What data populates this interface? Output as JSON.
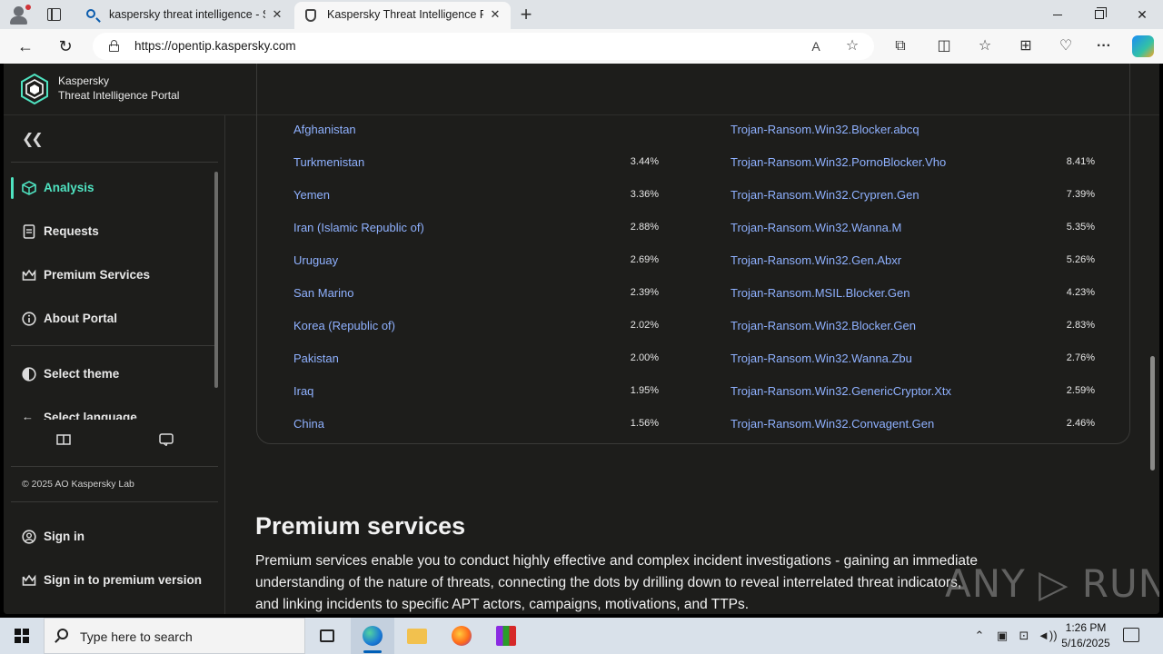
{
  "browser": {
    "tabs": [
      {
        "title": "kaspersky threat intelligence - Se",
        "icon": "search-icon",
        "active": false
      },
      {
        "title": "Kaspersky Threat Intelligence Por",
        "icon": "shield-icon",
        "active": true
      }
    ],
    "url": "https://opentip.kaspersky.com",
    "window_controls": {
      "minimize": "–",
      "close": "✕"
    },
    "nav": {
      "back": "←",
      "reload": "↻"
    },
    "toolbar": {
      "read_aloud": "A᷊",
      "favorite": "☆",
      "extensions": "⧉",
      "split": "◫",
      "favorites": "☆",
      "collections": "⊞",
      "performance": "♡",
      "more": "···"
    }
  },
  "header": {
    "brand_line1": "Kaspersky",
    "brand_line2": "Threat Intelligence Portal"
  },
  "sidebar": {
    "collapse": "«",
    "items": [
      {
        "label": "Analysis",
        "icon": "cube-icon",
        "active": true
      },
      {
        "label": "Requests",
        "icon": "document-icon",
        "active": false
      },
      {
        "label": "Premium Services",
        "icon": "crown-icon",
        "active": false
      },
      {
        "label": "About Portal",
        "icon": "info-icon",
        "active": false
      }
    ],
    "select_theme": "Select theme",
    "select_language": "Select language",
    "copyright": "© 2025 AO Kaspersky Lab",
    "sign_in": "Sign in",
    "sign_in_premium": "Sign in to premium version"
  },
  "stats_rows": [
    {
      "country": "Afghanistan",
      "country_pct": "",
      "verdict": "Trojan-Ransom.Win32.Blocker.abcq",
      "verdict_pct": ""
    },
    {
      "country": "Turkmenistan",
      "country_pct": "3.44%",
      "verdict": "Trojan-Ransom.Win32.PornoBlocker.Vho",
      "verdict_pct": "8.41%"
    },
    {
      "country": "Yemen",
      "country_pct": "3.36%",
      "verdict": "Trojan-Ransom.Win32.Crypren.Gen",
      "verdict_pct": "7.39%"
    },
    {
      "country": "Iran (Islamic Republic of)",
      "country_pct": "2.88%",
      "verdict": "Trojan-Ransom.Win32.Wanna.M",
      "verdict_pct": "5.35%"
    },
    {
      "country": "Uruguay",
      "country_pct": "2.69%",
      "verdict": "Trojan-Ransom.Win32.Gen.Abxr",
      "verdict_pct": "5.26%"
    },
    {
      "country": "San Marino",
      "country_pct": "2.39%",
      "verdict": "Trojan-Ransom.MSIL.Blocker.Gen",
      "verdict_pct": "4.23%"
    },
    {
      "country": "Korea (Republic of)",
      "country_pct": "2.02%",
      "verdict": "Trojan-Ransom.Win32.Blocker.Gen",
      "verdict_pct": "2.83%"
    },
    {
      "country": "Pakistan",
      "country_pct": "2.00%",
      "verdict": "Trojan-Ransom.Win32.Wanna.Zbu",
      "verdict_pct": "2.76%"
    },
    {
      "country": "Iraq",
      "country_pct": "1.95%",
      "verdict": "Trojan-Ransom.Win32.GenericCryptor.Xtx",
      "verdict_pct": "2.59%"
    },
    {
      "country": "China",
      "country_pct": "1.56%",
      "verdict": "Trojan-Ransom.Win32.Convagent.Gen",
      "verdict_pct": "2.46%"
    }
  ],
  "premium": {
    "title": "Premium services",
    "text": "Premium services enable you to conduct highly effective and complex incident investigations - gaining an immediate understanding of the nature of threats, connecting the dots by drilling down to reveal interrelated threat indicators, and linking incidents to specific APT actors, campaigns, motivations, and TTPs."
  },
  "watermark": "ANY ▷ RUN",
  "taskbar": {
    "search_placeholder": "Type here to search",
    "apps": [
      "task-view-icon",
      "edge-icon",
      "file-explorer-icon",
      "firefox-icon",
      "winrar-icon"
    ],
    "time": "1:26 PM",
    "date": "5/16/2025"
  },
  "colors": {
    "accent": "#4fe3c1",
    "link": "#8fb1ff",
    "page_bg": "#1d1d1b"
  }
}
